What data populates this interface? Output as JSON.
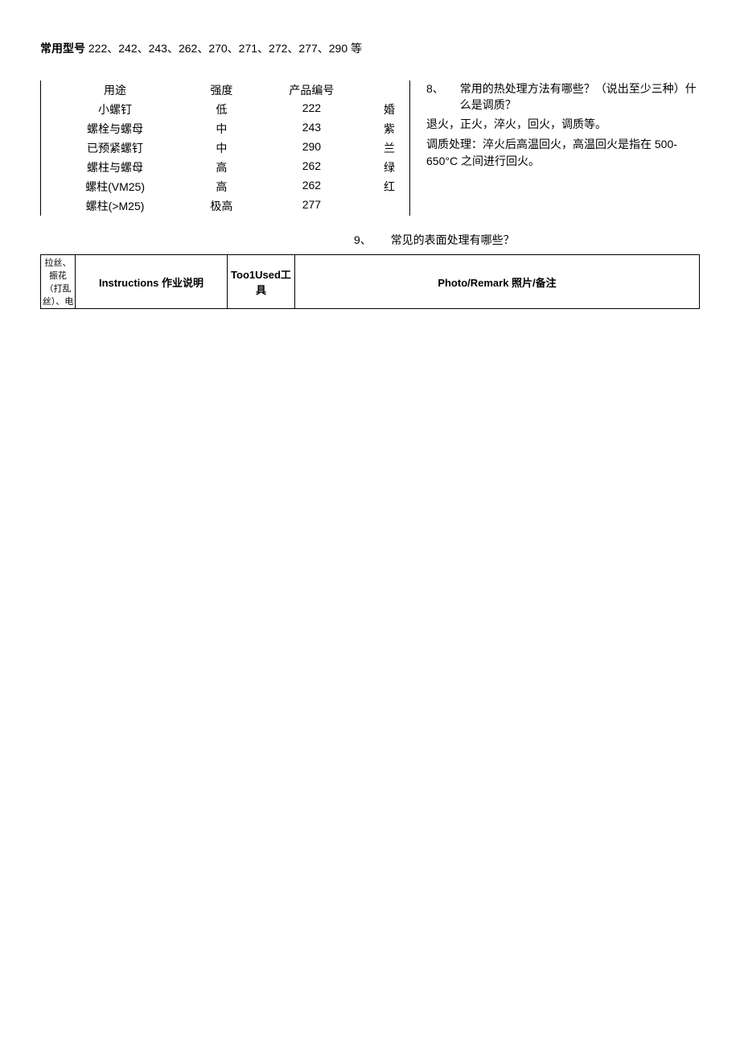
{
  "title": {
    "bold": "常用型号",
    "rest": "222、242、243、262、270、271、272、277、290 等"
  },
  "table": {
    "headers": [
      "用途",
      "强度",
      "产品编号",
      ""
    ],
    "rows": [
      [
        "小螺钉",
        "低",
        "222",
        "婚"
      ],
      [
        "螺栓与螺母",
        "中",
        "243",
        "紫"
      ],
      [
        "已预紧螺钉",
        "中",
        "290",
        "兰"
      ],
      [
        "螺柱与螺母",
        "高",
        "262",
        "绿"
      ],
      [
        "螺柱(VM25)",
        "高",
        "262",
        "红"
      ],
      [
        "螺柱(>M25)",
        "极高",
        "277",
        ""
      ]
    ]
  },
  "q8": {
    "num": "8、",
    "question": "常用的热处理方法有哪些？（说出至少三种）什么是调质？",
    "answer1": "退火，正火，淬火，回火，调质等。",
    "answer2": "调质处理：淬火后高温回火，高温回火是指在 500-650°C 之间进行回火。"
  },
  "q9": {
    "num": "9、",
    "question": "常见的表面处理有哪些？"
  },
  "bottom_table": {
    "col1": "拉丝、振花（打乱丝）、电",
    "col2": "Instructions 作业说明",
    "col3": "Too1Used工具",
    "col4": "Photo/Remark 照片/备注"
  }
}
